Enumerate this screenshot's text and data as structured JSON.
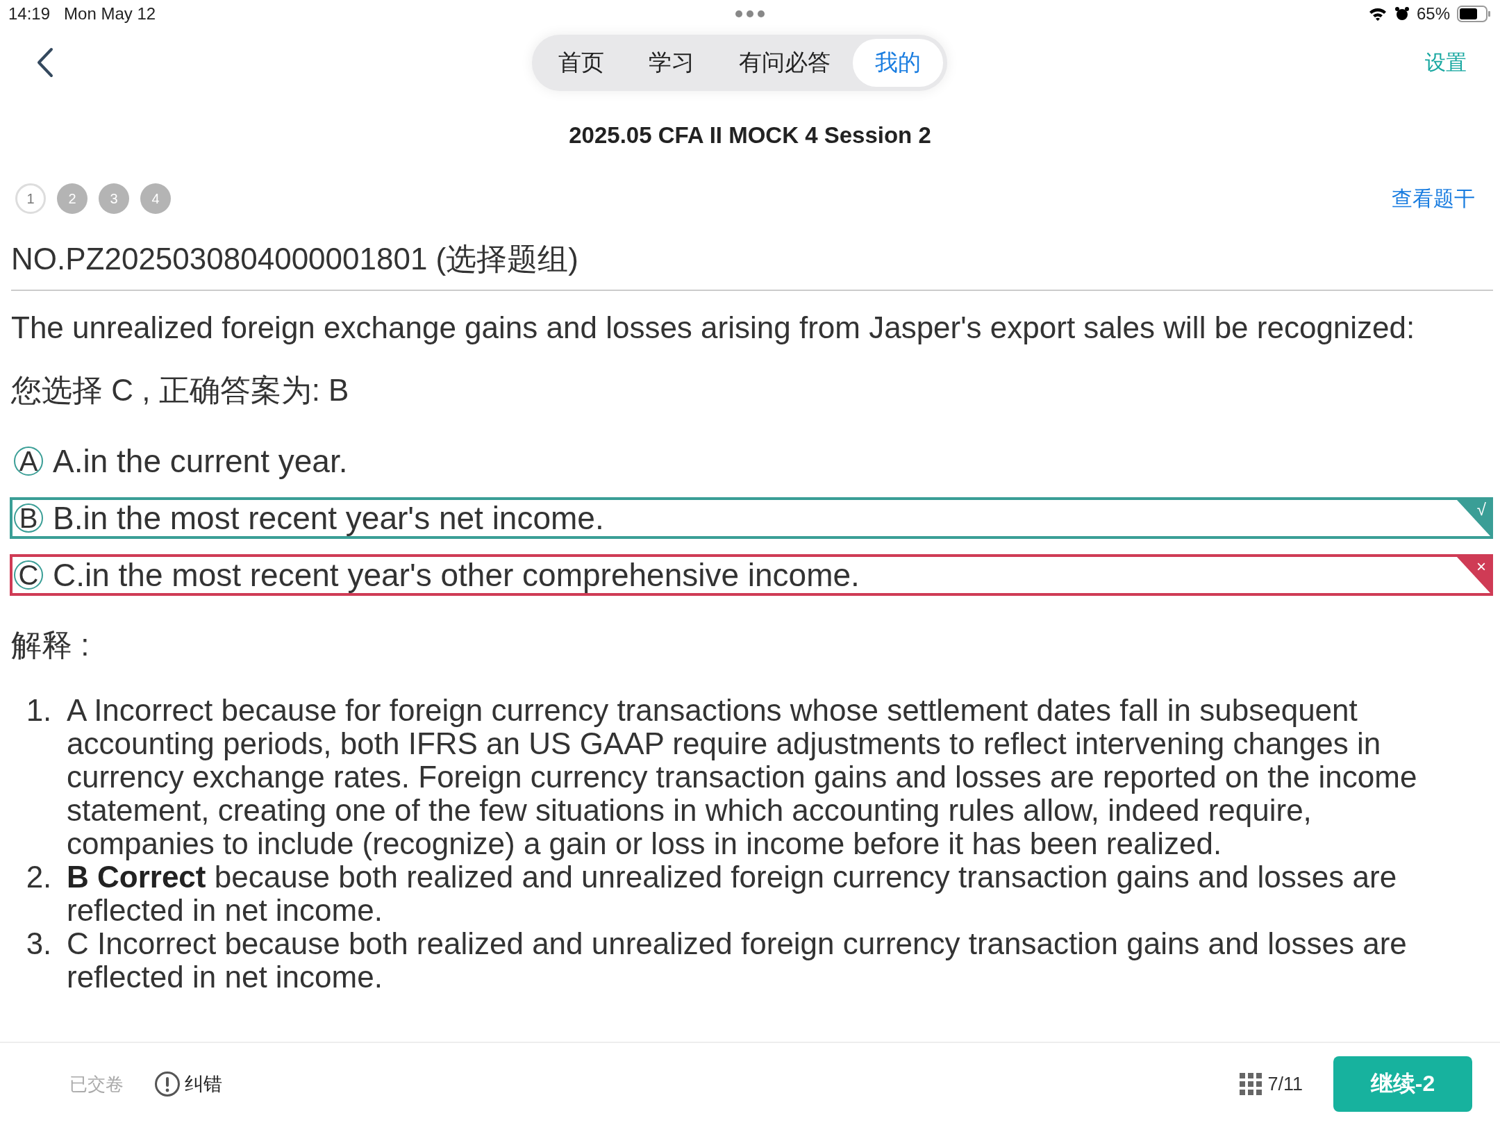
{
  "status_bar": {
    "time": "14:19",
    "date": "Mon May 12",
    "battery": "65%"
  },
  "nav": {
    "tabs": [
      {
        "label": "首页",
        "selected": false
      },
      {
        "label": "学习",
        "selected": false
      },
      {
        "label": "有问必答",
        "selected": false
      },
      {
        "label": "我的",
        "selected": true
      }
    ],
    "settings": "设置"
  },
  "title": "2025.05 CFA II MOCK 4 Session 2",
  "question_steps": [
    {
      "label": "1",
      "selected": true
    },
    {
      "label": "2",
      "selected": false
    },
    {
      "label": "3",
      "selected": false
    },
    {
      "label": "4",
      "selected": false
    }
  ],
  "view_stem": "查看题干",
  "question_id": "NO.PZ2025030804000001801 (选择题组)",
  "question": "The unrealized foreign exchange gains and losses arising from Jasper's export sales will be recognized:",
  "answer_line": "您选择 C , 正确答案为: B",
  "options": [
    {
      "letter": "A",
      "text": "A.in the current year.",
      "correct": false,
      "chosen": false
    },
    {
      "letter": "B",
      "text": "B.in the most recent year's net income.",
      "correct": true,
      "chosen": false,
      "mark": "√"
    },
    {
      "letter": "C",
      "text": "C.in the most recent year's other comprehensive income.",
      "correct": false,
      "chosen": true,
      "mark": "×"
    }
  ],
  "explanation_heading": "解释 :",
  "explanation": [
    {
      "number": "1.",
      "text": "A Incorrect because for foreign currency transactions whose settlement dates fall in subsequent accounting periods, both IFRS an US GAAP require adjustments to reflect intervening changes in currency exchange rates. Foreign currency transaction gains and losses are reported on the income statement, creating one of the few situations in which accounting rules allow, indeed require, companies to include (recognize) a gain or loss in income before it has been realized."
    },
    {
      "number": "2.",
      "text": "**B Correct** because both realized and unrealized foreign currency transaction gains and losses are reflected in net income."
    },
    {
      "number": "3.",
      "text": "C Incorrect because both realized and unrealized foreign currency transaction gains and losses are reflected in net income."
    }
  ],
  "bottom_bar": {
    "submitted": "已交卷",
    "report_error": "纠错",
    "progress": "7/11",
    "continue": "继续-2"
  }
}
